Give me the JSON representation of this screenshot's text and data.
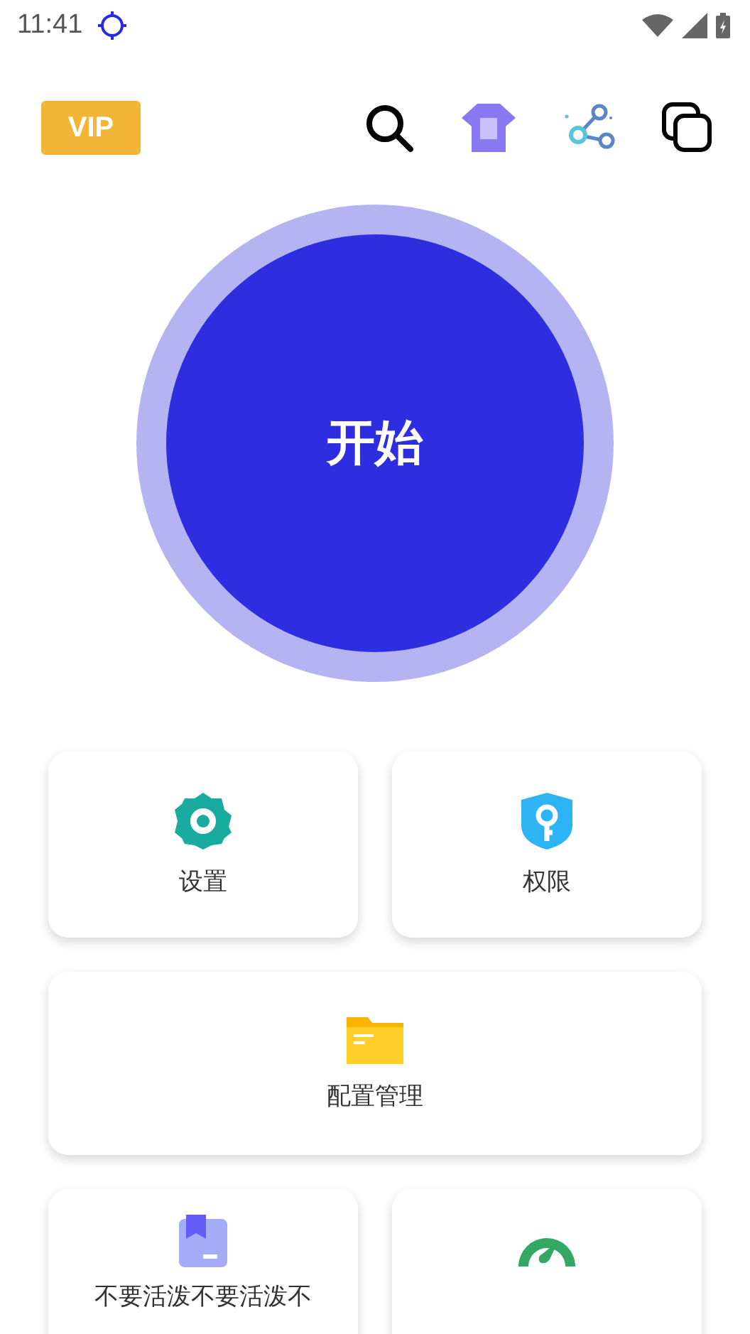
{
  "status_bar": {
    "time": "11:41"
  },
  "top_bar": {
    "vip": "VIP"
  },
  "start_button": {
    "label": "开始"
  },
  "tiles": [
    {
      "kind": "gear",
      "label": "设置",
      "wide": false
    },
    {
      "kind": "shield",
      "label": "权限",
      "wide": false
    },
    {
      "kind": "folder",
      "label": "配置管理",
      "wide": true
    },
    {
      "kind": "box",
      "label": "不要活泼不要活泼不",
      "wide": false
    },
    {
      "kind": "gauge",
      "wide": false
    }
  ]
}
